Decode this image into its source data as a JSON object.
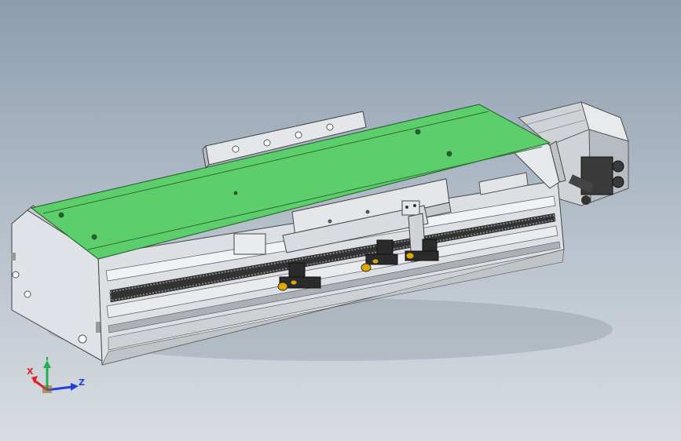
{
  "viewport": {
    "background_top": "#8c9db0",
    "background_bottom": "#d9dde1"
  },
  "model": {
    "carriage_color": "#5ccf6c",
    "body_color": "#dcdfe3",
    "sensor_color": "#2b2b2b",
    "sensor_accent": "#e0a800"
  },
  "triad": {
    "x_label": "X",
    "y_label": "Y",
    "z_label": "Z",
    "x_color": "#e0202a",
    "y_color": "#1fb24a",
    "z_color": "#1f3fe0"
  }
}
